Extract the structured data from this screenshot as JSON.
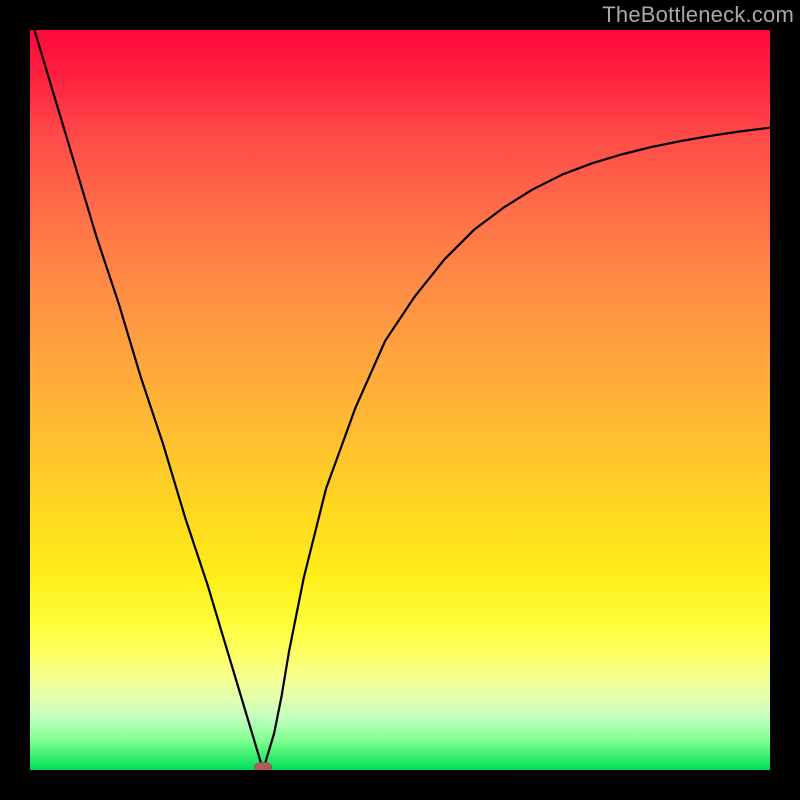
{
  "watermark": {
    "text": "TheBottleneck.com"
  },
  "chart_data": {
    "type": "line",
    "title": "",
    "xlabel": "",
    "ylabel": "",
    "xlim": [
      0,
      100
    ],
    "ylim": [
      0,
      100
    ],
    "grid": false,
    "legend": false,
    "note": "Values read off the curve in percent of the plot area; y is visual height from bottom edge.",
    "series": [
      {
        "name": "bottleneck-curve",
        "x": [
          0,
          3,
          6,
          9,
          12,
          15,
          18,
          21,
          24,
          27,
          30,
          31.5,
          33,
          34,
          35,
          37,
          40,
          44,
          48,
          52,
          56,
          60,
          64,
          68,
          72,
          76,
          80,
          84,
          88,
          92,
          96,
          100
        ],
        "y": [
          102,
          92,
          82,
          72,
          63,
          53,
          44,
          34,
          25,
          15,
          5,
          0,
          5,
          10,
          16,
          26,
          38,
          49,
          58,
          64,
          69,
          73,
          76,
          78.5,
          80.5,
          82,
          83.2,
          84.2,
          85,
          85.7,
          86.3,
          86.8
        ]
      }
    ],
    "marker": {
      "x": 31.5,
      "y": 0,
      "shape": "squished-oval",
      "color": "#b35a5a"
    },
    "background_gradient": {
      "type": "vertical",
      "stops": [
        {
          "pos": 0.0,
          "color": "#ff083a"
        },
        {
          "pos": 0.25,
          "color": "#ff7048"
        },
        {
          "pos": 0.55,
          "color": "#ffbf30"
        },
        {
          "pos": 0.8,
          "color": "#fffd3a"
        },
        {
          "pos": 0.93,
          "color": "#c0ffc0"
        },
        {
          "pos": 1.0,
          "color": "#00d85a"
        }
      ]
    }
  }
}
